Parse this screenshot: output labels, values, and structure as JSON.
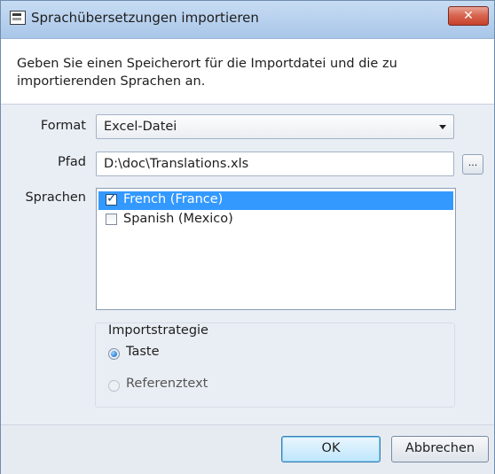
{
  "window": {
    "title": "Sprachübersetzungen importieren",
    "close_label": "✕"
  },
  "intro": {
    "text": "Geben Sie einen Speicherort für die Importdatei und die zu importierenden Sprachen an."
  },
  "form": {
    "format_label": "Format",
    "format_value": "Excel-Datei",
    "path_label": "Pfad",
    "path_value": "D:\\doc\\Translations.xls",
    "browse_label": "...",
    "languages_label": "Sprachen",
    "languages": [
      {
        "label": "French (France)",
        "checked": true,
        "selected": true
      },
      {
        "label": "Spanish (Mexico)",
        "checked": false,
        "selected": false
      }
    ]
  },
  "import_strategy": {
    "title": "Importstrategie",
    "options": [
      {
        "label": "Taste",
        "selected": true,
        "enabled": true
      },
      {
        "label": "Referenztext",
        "selected": false,
        "enabled": false
      }
    ]
  },
  "buttons": {
    "ok": "OK",
    "cancel": "Abbrechen"
  },
  "colors": {
    "selection": "#3399ff",
    "close_button": "#c6412b",
    "titlebar": "#b8d1ee"
  }
}
